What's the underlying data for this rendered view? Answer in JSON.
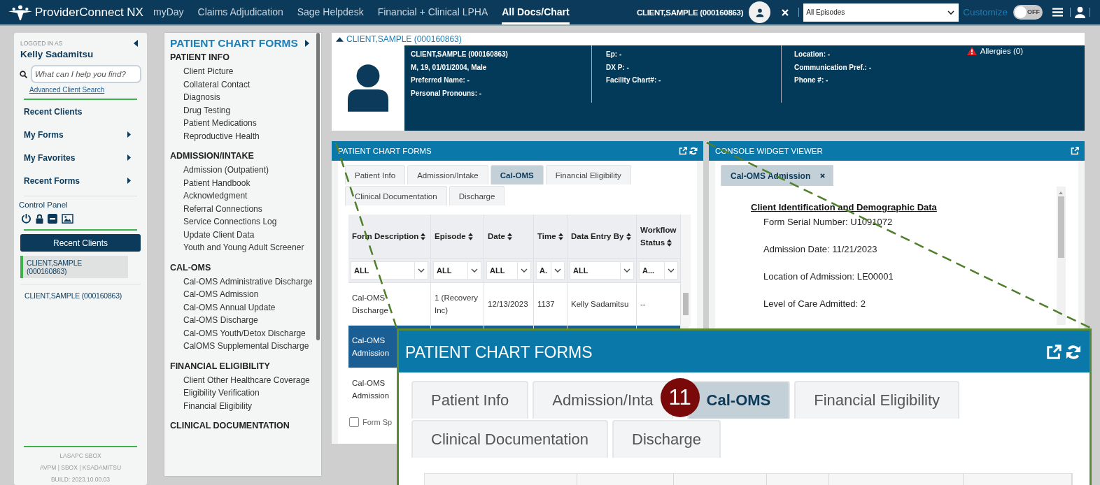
{
  "top_bar": {
    "logo": "ProviderConnect NX",
    "nav": [
      {
        "label": "myDay",
        "selected": false
      },
      {
        "label": "Claims Adjudication",
        "selected": false
      },
      {
        "label": "Sage Helpdesk",
        "selected": false
      },
      {
        "label": "Financial + Clinical LPHA",
        "selected": false
      },
      {
        "label": "All Docs/Chart",
        "selected": true
      }
    ],
    "client": "CLIENT,SAMPLE (000160863)",
    "episode_select": {
      "value": "All Episodes"
    },
    "customize": "Customize",
    "toggle": {
      "label": "OFF",
      "on": false
    }
  },
  "sidebar": {
    "logged_in_label": "LOGGED IN AS",
    "user": "Kelly Sadamitsu",
    "search": {
      "placeholder": "What can I help you find?"
    },
    "advanced_link": "Advanced Client Search",
    "menu": [
      {
        "label": "Recent Clients",
        "kind": "link"
      },
      {
        "label": "My Forms",
        "kind": "submenu"
      },
      {
        "label": "My Favorites",
        "kind": "submenu"
      },
      {
        "label": "Recent Forms",
        "kind": "submenu"
      }
    ],
    "control_panel": "Control Panel",
    "recent_button": "Recent Clients",
    "clients": [
      {
        "label": "CLIENT,SAMPLE (000160863)",
        "selected": true
      },
      {
        "label": "CLIENT,SAMPLE (000160863)",
        "selected": false
      }
    ],
    "footer": [
      "LASAPC SBOX",
      "AVPM | SBOX | KSADAMITSU",
      "BUILD: 2023.10.00.03"
    ]
  },
  "forms_menu": {
    "title": "PATIENT CHART FORMS",
    "sections": [
      {
        "heading": "PATIENT INFO",
        "items": [
          "Client Picture",
          "Collateral Contact",
          "Diagnosis",
          "Drug Testing",
          "Patient Medications",
          "Reproductive Health"
        ]
      },
      {
        "heading": "ADMISSION/INTAKE",
        "items": [
          "Admission (Outpatient)",
          "Patient Handbook",
          "Acknowledgment",
          "Referral Connections",
          "Service Connections Log",
          "Update Client Data",
          "Youth and Young Adult Screener"
        ]
      },
      {
        "heading": "CAL-OMS",
        "items": [
          "Cal-OMS Administrative Discharge",
          "Cal-OMS Admission",
          "Cal-OMS Annual Update",
          "Cal-OMS Discharge",
          "Cal-OMS Youth/Detox Discharge",
          "CalOMS Supplemental Discharge"
        ]
      },
      {
        "heading": "FINANCIAL ELIGIBILITY",
        "items": [
          "Client Other Healthcare Coverage",
          "Eligibility Verification",
          "Financial Eligibility"
        ]
      },
      {
        "heading": "CLINICAL DOCUMENTATION"
      }
    ]
  },
  "client_header": {
    "title": "CLIENT,SAMPLE (000160863)",
    "columns": [
      {
        "lines": [
          "CLIENT,SAMPLE (000160863)",
          "M, 19, 01/01/2004, Male",
          "Preferred Name: -",
          "Personal Pronouns: -"
        ]
      },
      {
        "lines": [
          "Ep: -",
          "DX P: -",
          "Facility Chart#: -"
        ]
      },
      {
        "lines": [
          "Location: -",
          "Communication Pref.: -",
          "Phone #: -"
        ]
      }
    ],
    "allergies": "Allergies (0)"
  },
  "chart_forms": {
    "title": "PATIENT CHART FORMS",
    "tab_rows": [
      {
        "tabs": [
          {
            "label": "Patient Info",
            "selected": false
          },
          {
            "label": "Admission/Intake",
            "selected": false
          },
          {
            "label": "Cal-OMS",
            "selected": true
          },
          {
            "label": "Financial Eligibility",
            "selected": false
          }
        ]
      },
      {
        "tabs": [
          {
            "label": "Clinical Documentation",
            "selected": false
          },
          {
            "label": "Discharge",
            "selected": false
          }
        ]
      }
    ],
    "table": {
      "columns": [
        "Form Description",
        "Episode",
        "Date",
        "Time",
        "Data Entry By",
        "Workflow Status"
      ],
      "filters": [
        "ALL",
        "ALL",
        "ALL",
        "A.",
        "ALL",
        "A..."
      ],
      "rows": [
        {
          "cells": [
            "Cal-OMS Discharge",
            "1 (Recovery Inc)",
            "12/13/2023",
            "1137",
            "Kelly Sadamitsu",
            "--"
          ],
          "selected": false
        },
        {
          "cells": [
            "Cal-OMS Admission"
          ],
          "selected": true
        },
        {
          "cells": [
            "Cal-OMS Admission"
          ],
          "selected": false
        }
      ]
    },
    "checkbox": {
      "label": "Form Sp",
      "checked": false
    }
  },
  "console": {
    "title": "CONSOLE WIDGET VIEWER",
    "tab": {
      "label": "Cal-OMS Admission"
    },
    "heading": "Client Identification and Demographic Data",
    "lines": [
      "Form Serial Number: U1091072",
      "Admission Date: 11/21/2023",
      "Location of Admission: LE00001",
      "Level of Care Admitted: 2"
    ]
  },
  "callout": {
    "title": "PATIENT CHART FORMS",
    "badge": "11",
    "tab_rows": [
      {
        "tabs": [
          {
            "label": "Patient Info",
            "selected": false
          },
          {
            "label": "Admission/Inta",
            "selected": false
          },
          {
            "label": "Cal-OMS",
            "selected": true
          },
          {
            "label": "Financial Eligibility",
            "selected": false
          }
        ]
      },
      {
        "tabs": [
          {
            "label": "Clinical Documentation",
            "selected": false
          },
          {
            "label": "Discharge",
            "selected": false
          }
        ]
      }
    ]
  }
}
